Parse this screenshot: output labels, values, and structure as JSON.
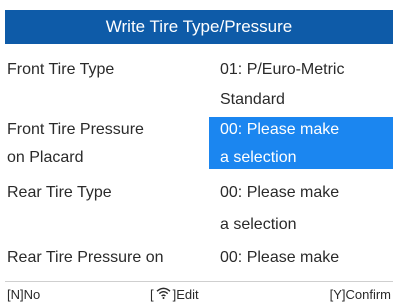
{
  "title": "Write Tire Type/Pressure",
  "rows": [
    {
      "label_line1": "Front Tire Type",
      "label_line2": "",
      "value_line1": "01: P/Euro-Metric",
      "value_line2": "Standard"
    },
    {
      "label_line1": "Front Tire Pressure",
      "label_line2": "on Placard",
      "value_line1": "00: Please make",
      "value_line2": "a selection"
    },
    {
      "label_line1": "Rear Tire Type",
      "label_line2": "",
      "value_line1": "00: Please make",
      "value_line2": "a selection"
    },
    {
      "label_line1": "Rear Tire Pressure on",
      "label_line2": "",
      "value_line1": "00: Please make",
      "value_line2": ""
    }
  ],
  "footer": {
    "no": "[N]No",
    "edit_open": "[",
    "edit": "]Edit",
    "confirm": "[Y]Confirm"
  },
  "colors": {
    "title_bar": "#0e5ba8",
    "selection": "#1b86f0"
  },
  "icons": {
    "edit": "wifi-icon"
  }
}
